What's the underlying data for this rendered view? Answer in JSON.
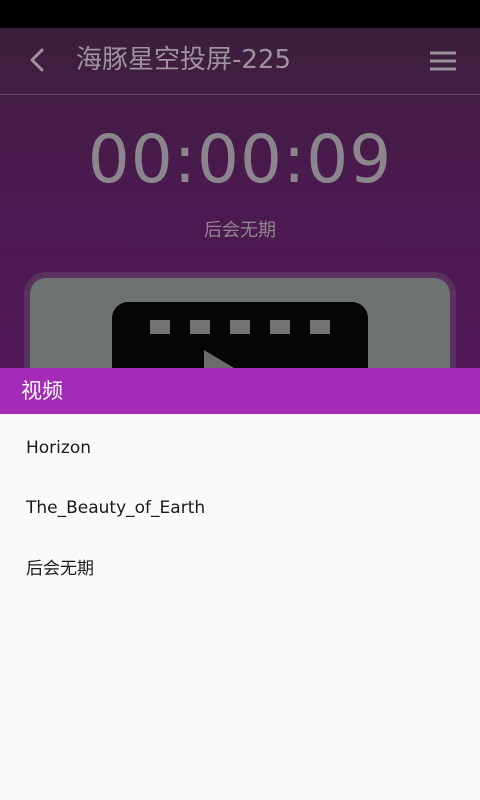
{
  "player": {
    "title": "海豚星空投屏-225",
    "timer": "00:00:09",
    "current_title": "后会无期"
  },
  "sheet": {
    "title": "视频",
    "items": [
      {
        "label": "Horizon"
      },
      {
        "label": "The_Beauty_of_Earth"
      },
      {
        "label": "后会无期"
      }
    ]
  },
  "icons": {
    "back": "chevron-left-icon",
    "menu": "menu-icon",
    "video": "video-clapper-icon"
  },
  "colors": {
    "status_bar": "#000000",
    "player_background": "#4a1a4e",
    "sheet_header": "#a22bb7",
    "sheet_background": "#fafafa",
    "text_primary": "#1a1a1a"
  }
}
